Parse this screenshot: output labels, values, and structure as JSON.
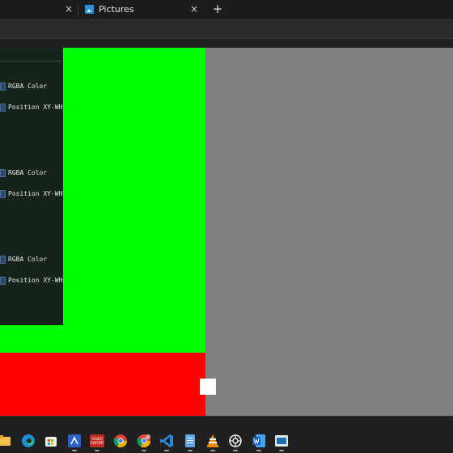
{
  "tabs": [
    {
      "label": "Pictures",
      "icon": "pictures-icon"
    }
  ],
  "tab_controls": {
    "close_glyph": "×",
    "new_tab_glyph": "+"
  },
  "inspector": {
    "groups": [
      {
        "color_label": "RGBA Color",
        "position_label": "Position XY-WH"
      },
      {
        "color_label": "RGBA Color",
        "position_label": "Position XY-WH"
      },
      {
        "color_label": "RGBA Color",
        "position_label": "Position XY-WH"
      }
    ]
  },
  "canvas": {
    "background": "#808080",
    "shapes": [
      {
        "name": "green-rectangle",
        "color": "#00ff00"
      },
      {
        "name": "red-rectangle",
        "color": "#ff0000"
      },
      {
        "name": "white-square",
        "color": "#ffffff"
      }
    ]
  },
  "taskbar": {
    "apps": [
      "file-explorer-icon",
      "edge-icon",
      "store-icon",
      "vs-blue-icon",
      "video-editor-icon",
      "chrome-icon",
      "chrome-profile-icon",
      "vscode-icon",
      "notepad-icon",
      "vlc-icon",
      "chatgpt-icon",
      "word-icon",
      "app-window-icon"
    ],
    "video_editor_text": [
      "VIDEO",
      "EDITOR"
    ]
  }
}
